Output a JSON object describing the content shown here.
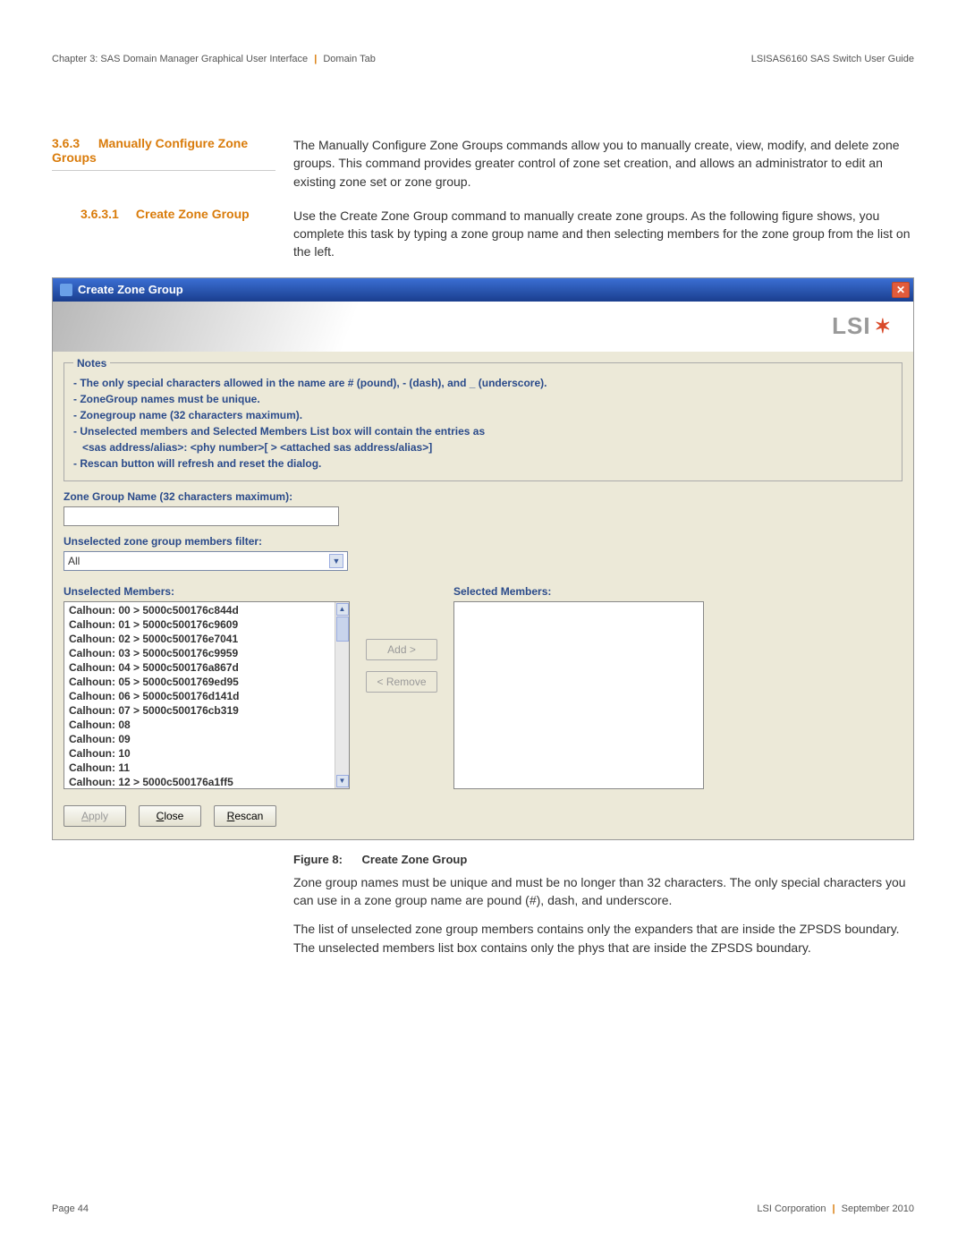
{
  "header": {
    "left_chapter": "Chapter 3: SAS Domain Manager Graphical User Interface",
    "left_tab": "Domain Tab",
    "right": "LSISAS6160 SAS Switch User Guide"
  },
  "section1": {
    "num": "3.6.3",
    "title": "Manually Configure Zone Groups",
    "body": "The Manually Configure Zone Groups commands allow you to manually create, view, modify, and delete zone groups. This command provides greater control of zone set creation, and allows an administrator to edit an existing zone set or zone group."
  },
  "section2": {
    "num": "3.6.3.1",
    "title": "Create Zone Group",
    "body": "Use the Create Zone Group command to manually create zone groups. As the following figure shows, you complete this task by typing a zone group name and then selecting members for the zone group from the list on the left."
  },
  "dialog": {
    "title": "Create Zone Group",
    "logo": "LSI",
    "notes_legend": "Notes",
    "notes": [
      "- The only special characters allowed in the name are # (pound), - (dash), and _ (underscore).",
      "- ZoneGroup names must be unique.",
      "- Zonegroup name (32 characters maximum).",
      "- Unselected members and Selected Members List box will contain the entries as",
      "  <sas address/alias>: <phy number>[ > <attached sas address/alias>]",
      "- Rescan button will refresh and reset the dialog."
    ],
    "zg_label": "Zone Group Name (32 characters maximum):",
    "filter_label": "Unselected zone group members filter:",
    "filter_value": "All",
    "unsel_label": "Unselected Members:",
    "sel_label": "Selected Members:",
    "unselected": [
      "Calhoun: 00 > 5000c500176c844d",
      "Calhoun: 01 > 5000c500176c9609",
      "Calhoun: 02 > 5000c500176e7041",
      "Calhoun: 03 > 5000c500176c9959",
      "Calhoun: 04 > 5000c500176a867d",
      "Calhoun: 05 > 5000c5001769ed95",
      "Calhoun: 06 > 5000c500176d141d",
      "Calhoun: 07 > 5000c500176cb319",
      "Calhoun: 08",
      "Calhoun: 09",
      "Calhoun: 10",
      "Calhoun: 11",
      "Calhoun: 12 > 5000c500176a1ff5"
    ],
    "add_btn": "Add >",
    "remove_btn": "< Remove",
    "apply_btn": "Apply",
    "close_btn": "Close",
    "rescan_btn": "Rescan"
  },
  "figure": {
    "num": "Figure 8:",
    "title": "Create Zone Group"
  },
  "para1": "Zone group names must be unique and must be no longer than 32 characters. The only special characters you can use in a zone group name are pound (#), dash, and underscore.",
  "para2": "The list of unselected zone group members contains only the expanders that are inside the ZPSDS boundary. The unselected members list box contains only the phys that are inside the ZPSDS boundary.",
  "footer": {
    "page": "Page 44",
    "corp": "LSI Corporation",
    "date": "September 2010"
  }
}
